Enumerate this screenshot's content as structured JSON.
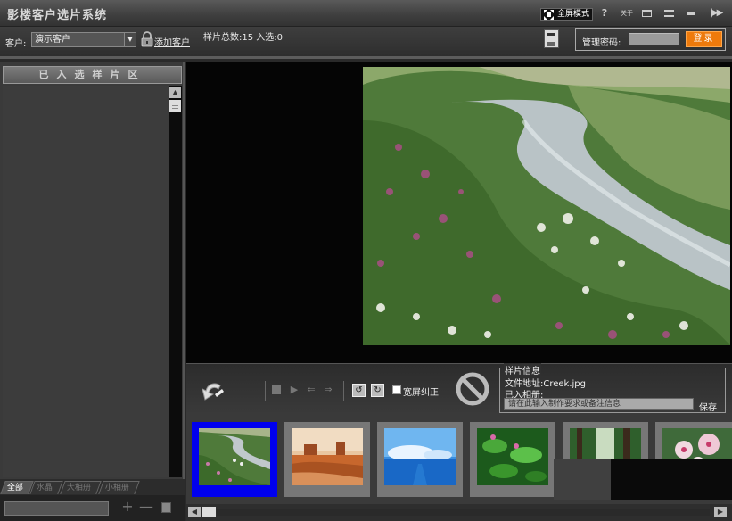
{
  "app": {
    "title": "影楼客户选片系统"
  },
  "titlebar": {
    "fullscreen_label": "全屏模式",
    "help_icon": "question-mark-icon",
    "help_glyph": "?",
    "about_label": "关于",
    "restore_icon": "restore-window-icon",
    "layout_icon": "layout-icon",
    "minimize_icon": "minimize-icon",
    "exit_icon": "exit-arrows-icon",
    "exit_glyph": "|▶▶"
  },
  "toolbar": {
    "client_label": "客户:",
    "client_selected": "演示客户",
    "add_client_label": "添加客户",
    "sample_stats": "样片总数:15  入选:0",
    "admin_password_label": "管理密码:",
    "login_label": "登录"
  },
  "left_panel": {
    "title": "已入选样片区",
    "scroll_up_glyph": "▲",
    "filter_tabs": [
      {
        "label": "全部",
        "active": true
      },
      {
        "label": "水晶",
        "active": false
      },
      {
        "label": "大相册",
        "active": false
      },
      {
        "label": "小相册",
        "active": false
      }
    ],
    "plus_glyph": "+",
    "minus_glyph": "—"
  },
  "controls": {
    "stop_icon": "stop-icon",
    "play_glyph": "▶",
    "prev_glyph": "⇐",
    "next_glyph": "⇒",
    "rotate_left_glyph": "↺",
    "rotate_right_glyph": "↻",
    "widescreen_label": "宽屏纠正"
  },
  "info": {
    "title": "样片信息",
    "file_path": "文件地址:Creek.jpg",
    "album_label": "已入相册:",
    "note_placeholder": "请在此输入制作要求或备注信息",
    "save_label": "保存"
  },
  "thumbnails": [
    {
      "subject": "creek",
      "selected": true
    },
    {
      "subject": "desert",
      "selected": false
    },
    {
      "subject": "ocean",
      "selected": false
    },
    {
      "subject": "leaves",
      "selected": false
    },
    {
      "subject": "forest",
      "selected": false
    },
    {
      "subject": "flowers",
      "selected": false
    }
  ],
  "thumb_scrollbar": {
    "left_glyph": "◀",
    "right_glyph": "▶"
  },
  "colors": {
    "accent_login": "#ee7a0c",
    "selected_thumb": "#0000ee"
  }
}
